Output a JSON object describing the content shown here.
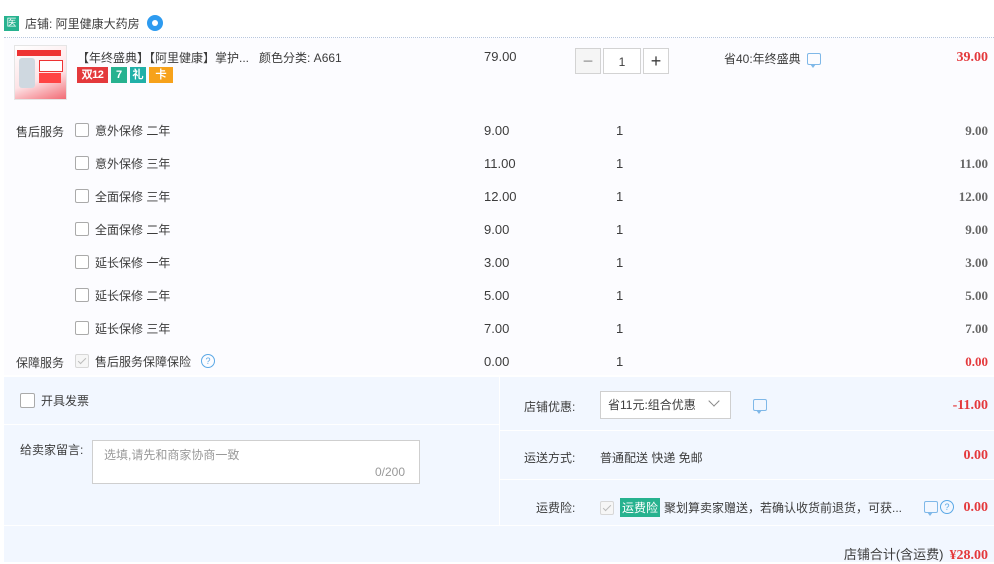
{
  "shop": {
    "icon_text": "医",
    "name": "店铺: 阿里健康大药房"
  },
  "item": {
    "title": "【年终盛典】【阿里健康】掌护...",
    "sku": "颜色分类: A661",
    "badges": [
      "双12",
      "7",
      "礼",
      "卡"
    ],
    "unit_price": "79.00",
    "qty": "1",
    "qty_minus": "−",
    "qty_plus": "+",
    "promo": "省40:年终盛典",
    "total": "39.00"
  },
  "after_sales": {
    "label": "售后服务",
    "options": [
      {
        "name": "意外保修 二年",
        "price": "9.00",
        "qty": "1",
        "total": "9.00"
      },
      {
        "name": "意外保修 三年",
        "price": "11.00",
        "qty": "1",
        "total": "11.00"
      },
      {
        "name": "全面保修 三年",
        "price": "12.00",
        "qty": "1",
        "total": "12.00"
      },
      {
        "name": "全面保修 二年",
        "price": "9.00",
        "qty": "1",
        "total": "9.00"
      },
      {
        "name": "延长保修 一年",
        "price": "3.00",
        "qty": "1",
        "total": "3.00"
      },
      {
        "name": "延长保修 二年",
        "price": "5.00",
        "qty": "1",
        "total": "5.00"
      },
      {
        "name": "延长保修 三年",
        "price": "7.00",
        "qty": "1",
        "total": "7.00"
      }
    ]
  },
  "guarantee": {
    "label": "保障服务",
    "name": "售后服务保障保险",
    "help": "?",
    "price": "0.00",
    "qty": "1",
    "total": "0.00"
  },
  "invoice": {
    "label": "开具发票"
  },
  "message": {
    "label": "给卖家留言:",
    "placeholder": "选填,请先和商家协商一致",
    "counter": "0/200"
  },
  "discount": {
    "label": "店铺优惠:",
    "selected": "省11元:组合优惠",
    "amount": "-11.00"
  },
  "shipping": {
    "label": "运送方式:",
    "method": "普通配送 快递 免邮",
    "amount": "0.00"
  },
  "insurance": {
    "label": "运费险:",
    "tag": "运费险",
    "text": "聚划算卖家赠送，若确认收货前退货，可获...",
    "help": "?",
    "amount": "0.00"
  },
  "grand_total": {
    "label": "店铺合计(含运费)",
    "value": "¥28.00"
  },
  "colors": {
    "price_red": "#e4393c",
    "accent_green": "#27b28f",
    "panel_bg": "#f2f7ff"
  }
}
